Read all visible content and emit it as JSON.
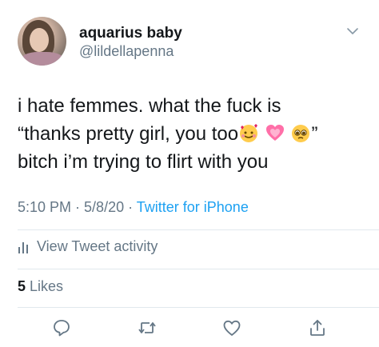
{
  "user": {
    "display_name": "aquarius baby",
    "handle": "@lildellapenna"
  },
  "tweet": {
    "line1": "i hate femmes. what the fuck is",
    "line2_prefix": "“thanks pretty girl, you too",
    "line2_suffix": "”",
    "line3": "bitch i’m trying to flirt with you",
    "emojis": [
      "smiling-face-with-hearts",
      "growing-heart",
      "pleading-face"
    ]
  },
  "meta": {
    "time": "5:10 PM",
    "sep1": " · ",
    "date": "5/8/20",
    "sep2": " · ",
    "source": "Twitter for iPhone"
  },
  "activity": {
    "label": "View Tweet activity"
  },
  "likes": {
    "count": "5",
    "label": " Likes"
  },
  "actions": {
    "icons": [
      "reply-icon",
      "retweet-icon",
      "like-icon",
      "share-icon"
    ]
  },
  "colors": {
    "text": "#14171a",
    "muted": "#657786",
    "link": "#1da1f2",
    "divider": "#e1e8ed"
  }
}
